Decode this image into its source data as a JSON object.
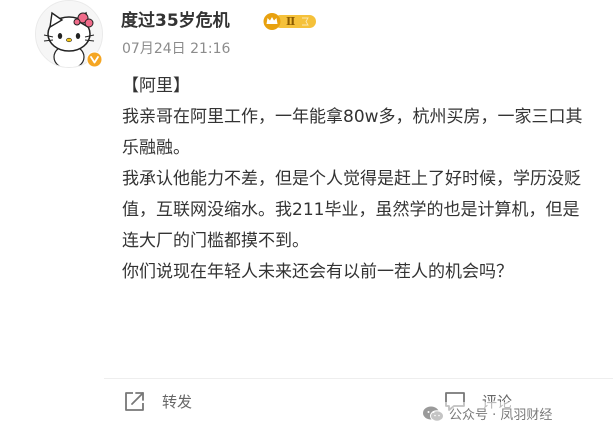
{
  "post": {
    "username": "度过35岁危机",
    "vip_level": "Ⅱ",
    "timestamp": "07月24日 21:16",
    "lines": [
      "【阿里】",
      "我亲哥在阿里工作，一年能拿80w多，杭州买房，一家三口其乐融融。",
      "我承认他能力不差，但是个人觉得是赶上了好时候，学历没贬值，互联网没缩水。我211毕业，虽然学的也是计算机，但是连大厂的门槛都摸不到。",
      "你们说现在年轻人未来还会有以前一茬人的机会吗？"
    ]
  },
  "actions": {
    "repost_label": "转发",
    "comment_label": "评论"
  },
  "watermark": {
    "text": "公众号 · 凤羽财经"
  },
  "colors": {
    "text_primary": "#333333",
    "text_secondary": "#8c8c8c",
    "verified_orange": "#f5a623",
    "vip_gold": "#f2b01e"
  },
  "icons": {
    "verified": "verified-badge-icon",
    "vip": "vip-crown-icon",
    "repost": "repost-icon",
    "comment": "comment-icon",
    "watermark": "wechat-icon"
  }
}
